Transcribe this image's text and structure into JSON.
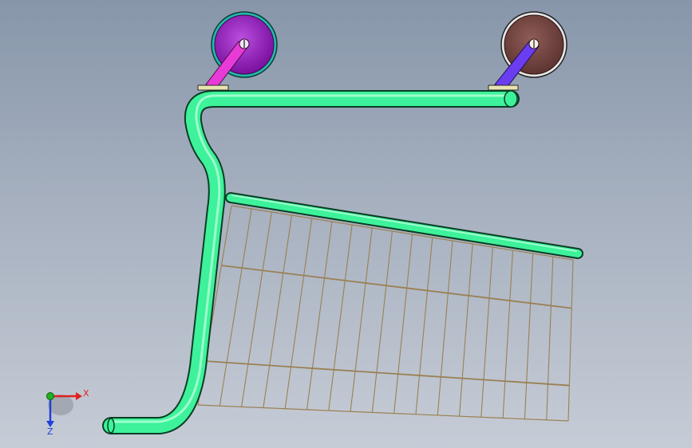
{
  "viewport": {
    "model": "shopping-cart-side-view",
    "background_top": "#8796aa",
    "background_bottom": "#c6ccd6"
  },
  "colors": {
    "tube": "#3df29a",
    "tube_outline": "#0b3d24",
    "mesh": "#9a8054",
    "left_wheel": "#9a1fc4",
    "left_wheel_rim": "#2ad9c9",
    "left_bracket": "#e83ad6",
    "right_wheel": "#7a4a46",
    "right_wheel_rim": "#e6e6e6",
    "right_bracket": "#6a3df0",
    "mount_plate": "#e8e4b0",
    "axis_x": "#e02020",
    "axis_y": "#1fb31f",
    "axis_z": "#2040d8"
  },
  "triad": {
    "x_label": "X",
    "z_label": "Z"
  }
}
